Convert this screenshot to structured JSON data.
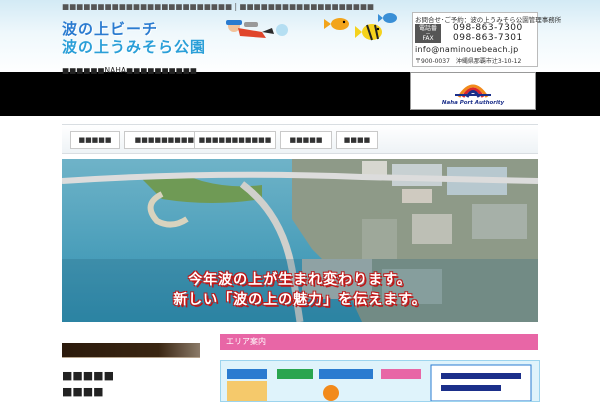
{
  "header": {
    "tagline": "■■■■■■■■■■■■■■■■■■■■■■■■ | ■■■■■■■■■■■■■■■■■■■",
    "logo_line1": "波の上ビーチ",
    "logo_line2": "波の上うみそら公園",
    "subtitle": "■■■■■■NAHA■■■■■■■■■■"
  },
  "contact": {
    "title": "お問合せ･ご予約：波の上うみそら公園管理事務所",
    "phone_tag": "電話番号",
    "phone": "098-863-7300",
    "fax_tag": "FAX",
    "fax": "098-863-7301",
    "email": "info@naminouebeach.jp",
    "address": "〒900-0037　沖縄県那覇市辻3-10-12"
  },
  "npa": {
    "label": "Naha Port Authority"
  },
  "nav": {
    "items": [
      {
        "label": "■■■■■"
      },
      {
        "label": "■■■■■■■■■■■"
      },
      {
        "label": "■■■■■■■■■■■"
      },
      {
        "label": "■■■■■"
      },
      {
        "label": "■■■■"
      }
    ]
  },
  "hero": {
    "caption_line1": "今年波の上が生まれ変わります。",
    "caption_line2": "新しい「波の上の魅力」を伝えます。"
  },
  "sidebar": {
    "text1": "■■■■■",
    "text2": "■■■■"
  },
  "area": {
    "heading": "エリア案内"
  },
  "colors": {
    "accent_pink": "#e866a6",
    "brand_blue": "#2a7bd0",
    "caption_red": "#c01717"
  }
}
